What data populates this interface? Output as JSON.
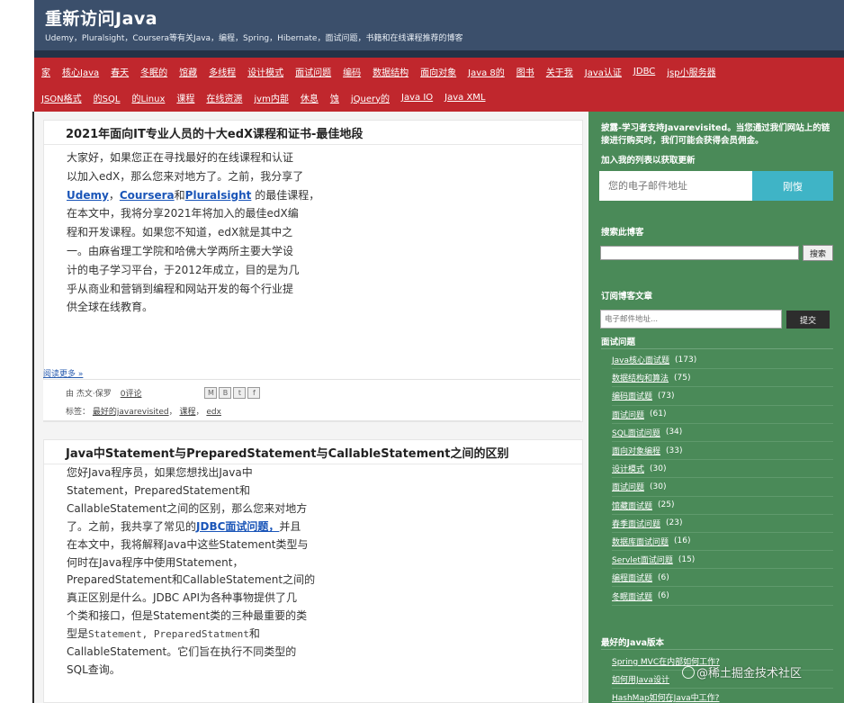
{
  "header": {
    "title": "重新访问Java",
    "subtitle": "Udemy，Pluralsight，Coursera等有关Java，编程，Spring，Hibernate，面试问题，书籍和在线课程推荐的博客"
  },
  "nav": {
    "row1": [
      "家",
      "核心Java",
      "春天",
      "冬眠的",
      "馆藏",
      "多线程",
      "设计模式",
      "面试问题",
      "编码",
      "数据结构",
      "面向对象",
      "Java 8的",
      "图书",
      "关于我",
      "Java认证",
      "JDBC",
      "jsp小服务器"
    ],
    "row2": [
      "JSON格式",
      "的SQL",
      "的Linux",
      "课程",
      "在线资源",
      "jvm内部",
      "休息",
      "蚀",
      "jQuery的",
      "Java IO",
      "Java XML"
    ]
  },
  "post1": {
    "title": "2021年面向IT专业人员的十大edX课程和证书-最佳地段",
    "body_lines": [
      "大家好，如果您正在寻找最好的在线课程和认证",
      "以加入edX，那么您来对地方了。之前，我分享了"
    ],
    "link_udemy": "Udemy",
    "sep1": "，",
    "link_coursera": "Coursera",
    "and": "和",
    "link_pluralsight": "Pluralsight",
    "after_links": " 的最佳课程，",
    "body_rest": [
      "在本文中，我将分享2021年将加入的最佳edX编",
      "程和开发课程。如果您不知道，edX就是其中之",
      "一。由麻省理工学院和哈佛大学两所主要大学设",
      "计的电子学习平台，于2012年成立，目的是为几",
      "乎从商业和营销到编程和网站开发的每个行业提",
      "供全球在线教育。"
    ],
    "read_more": "阅读更多 »",
    "author_prefix": "由 杰文·保罗",
    "comments": "0评论",
    "share_icons": [
      "email-icon",
      "blog-icon",
      "twitter-icon",
      "facebook-icon"
    ],
    "share_glyphs": [
      "M",
      "B",
      "t",
      "f"
    ],
    "labels_prefix": "标签：",
    "labels": [
      "最好的javarevisited",
      "课程",
      "edx"
    ],
    "label_seps": [
      "，",
      "，"
    ]
  },
  "post2": {
    "title": "Java中Statement与PreparedStatement与CallableStatement之间的区别",
    "lines_before": [
      "您好Java程序员，如果您想找出Java中",
      "Statement，PreparedStatement和",
      "CallableStatement之间的区别，那么您来对地方"
    ],
    "pre_link": "了。之前，我共享了常见的",
    "link_jdbc": "JDBC面试问题，",
    "post_link": "并且",
    "lines_after": [
      "在本文中，我将解释Java中这些Statement类型与",
      "何时在Java程序中使用Statement，",
      "PreparedStatement和CallableStatement之间的",
      "真正区别是什么。JDBC API为各种事物提供了几",
      "个类和接口，但是Statement类的三种最重要的类"
    ],
    "type_prefix": "型是",
    "code_types": "Statement, PreparedStatment",
    "type_and": "和",
    "last_lines": [
      "CallableStatement。它们旨在执行不同类型的",
      "SQL查询。"
    ]
  },
  "sidebar": {
    "disclaimer": "披露-学习者支持Javarevisited。当您通过我们网站上的链接进行购买时，我们可能会获得会员佣金。",
    "join_label": "加入我的列表以获取更新",
    "email_placeholder": "您的电子邮件地址",
    "subscribe_label": "刚愎",
    "search_title": "搜索此博客",
    "search_button": "搜索",
    "subscribe_title": "订阅博客文章",
    "email_small_placeholder": "电子邮件地址...",
    "submit_label": "提交",
    "iq_title": "面试问题",
    "iq_items": [
      {
        "label": "Java核心面试题",
        "count": "(173)"
      },
      {
        "label": "数据结构和算法",
        "count": "(75)"
      },
      {
        "label": "编码面试题",
        "count": "(73)"
      },
      {
        "label": "面试问题",
        "count": "(61)"
      },
      {
        "label": "SQL面试问题",
        "count": "(34)"
      },
      {
        "label": "面向对象编程",
        "count": "(33)"
      },
      {
        "label": "设计模式",
        "count": "(30)"
      },
      {
        "label": "面试问题",
        "count": "(30)"
      },
      {
        "label": "馆藏面试题",
        "count": "(25)"
      },
      {
        "label": "春季面试问题",
        "count": "(23)"
      },
      {
        "label": "数据库面试问题",
        "count": "(16)"
      },
      {
        "label": "Servlet面试问题",
        "count": "(15)"
      },
      {
        "label": "编程面试题",
        "count": "(6)"
      },
      {
        "label": "冬眠面试题",
        "count": "(6)"
      }
    ],
    "best_title": "最好的Java版本",
    "best_items": [
      "Spring MVC在内部如何工作?",
      "如何用Java设计",
      "HashMap如何在Java中工作?"
    ]
  },
  "watermark": "@稀土掘金技术社区"
}
